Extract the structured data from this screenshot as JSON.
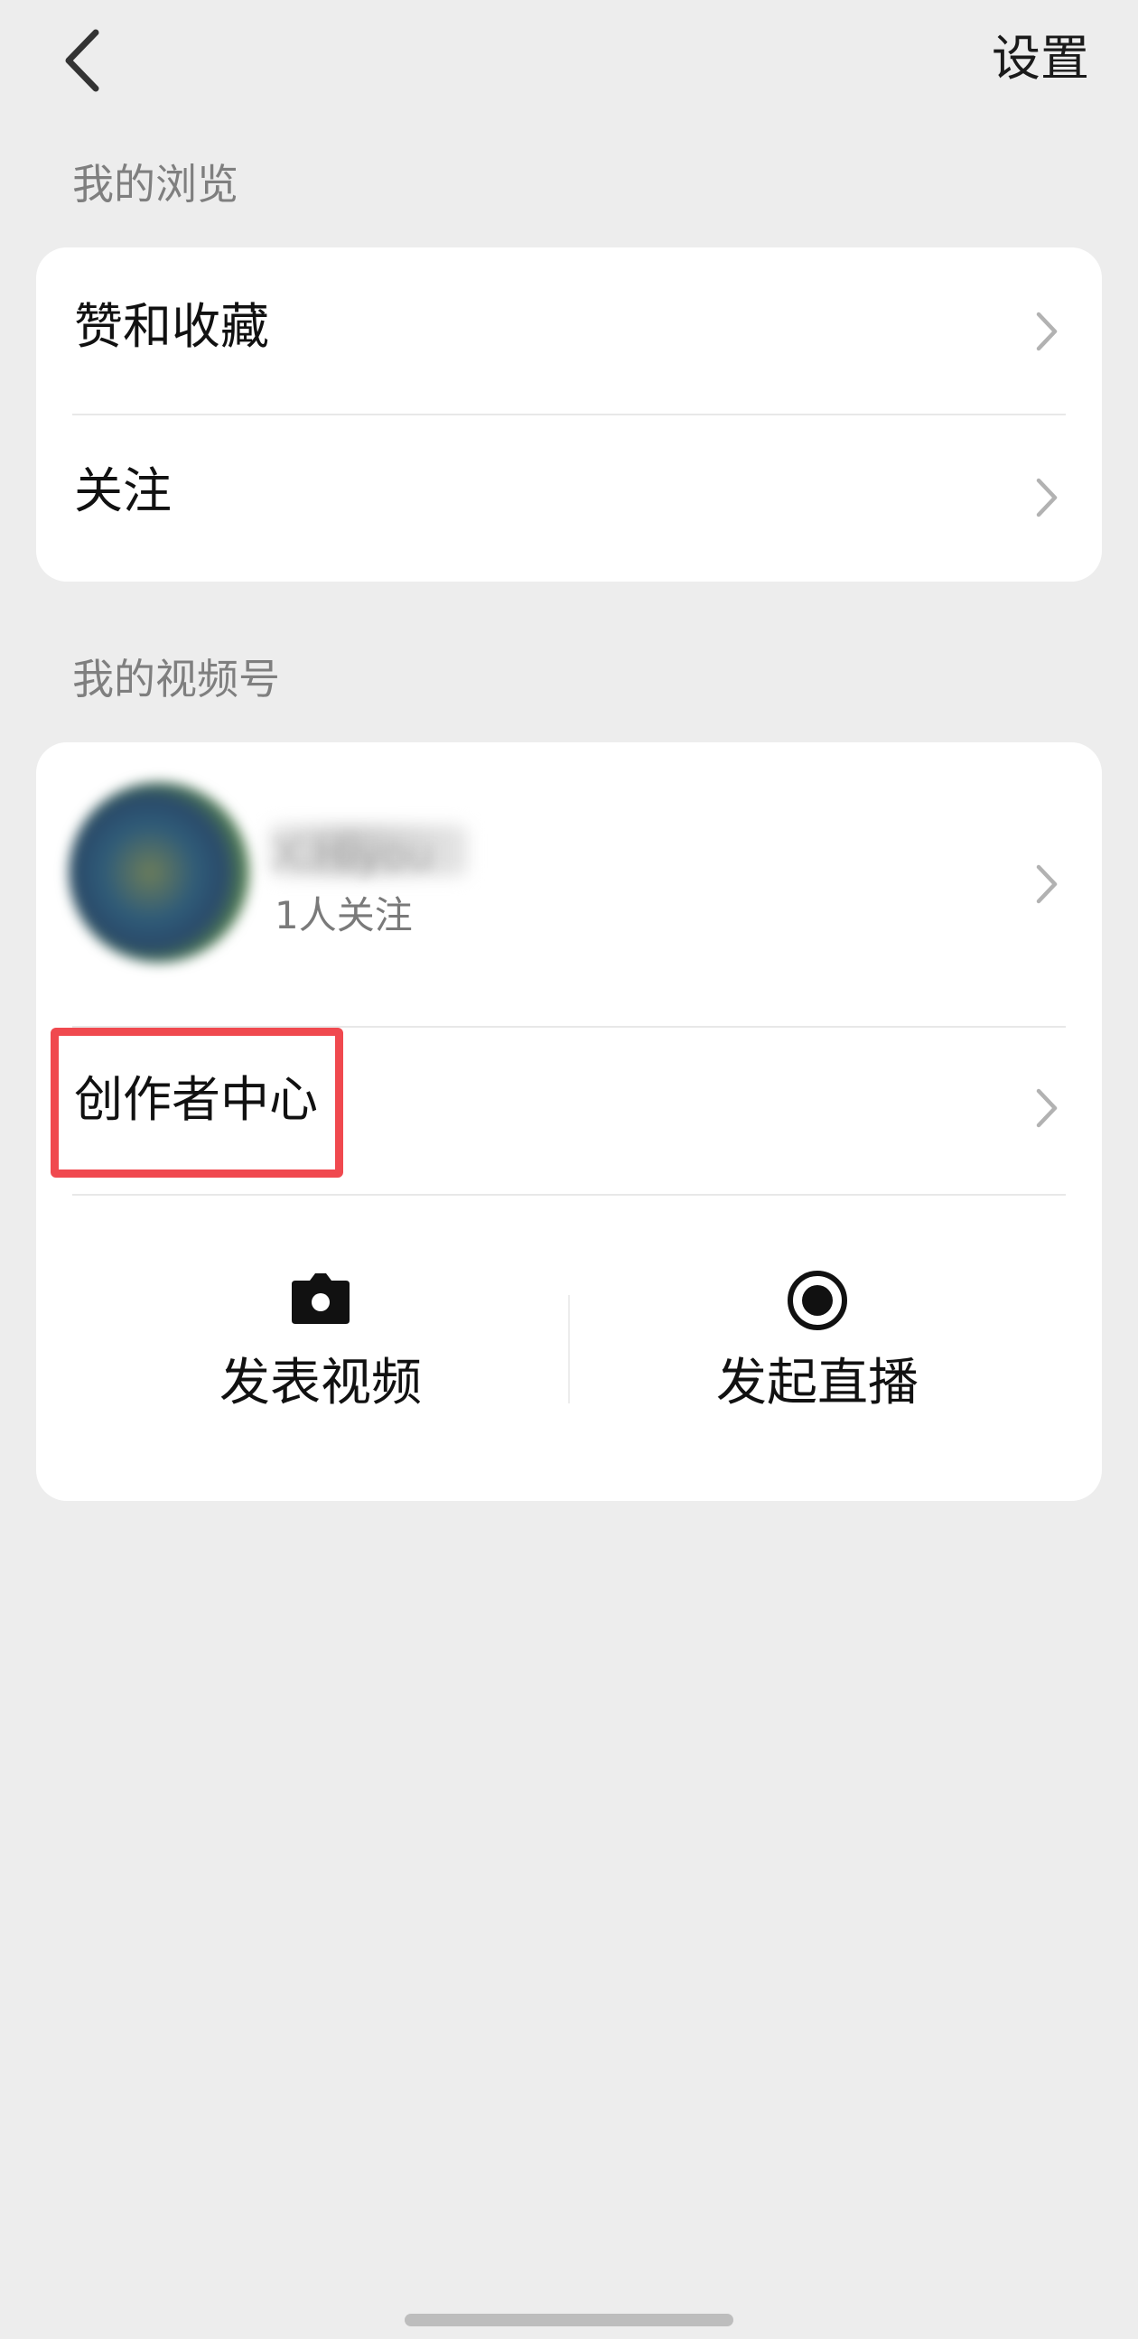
{
  "header": {
    "settings_label": "设置"
  },
  "browse_section": {
    "title": "我的浏览",
    "items": [
      {
        "label": "赞和收藏"
      },
      {
        "label": "关注"
      }
    ]
  },
  "channels_section": {
    "title": "我的视频号",
    "profile": {
      "name": "X.Hiyou",
      "followers": "1人关注"
    },
    "creator_center_label": "创作者中心",
    "actions": [
      {
        "label": "发表视频",
        "icon": "camera-icon"
      },
      {
        "label": "发起直播",
        "icon": "live-record-icon"
      }
    ]
  },
  "colors": {
    "background": "#ededed",
    "card": "#ffffff",
    "highlight": "#f0494f",
    "secondary_text": "#7f7f7f"
  }
}
